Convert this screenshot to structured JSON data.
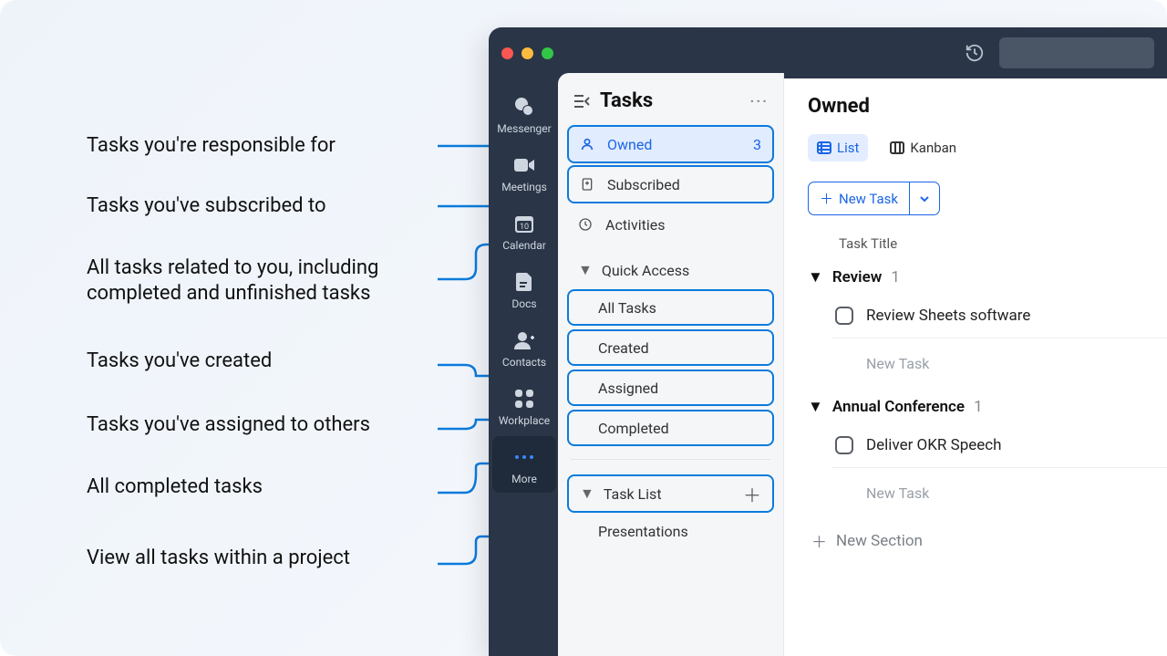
{
  "callouts": {
    "owned": "Tasks you're responsible for",
    "subscribed": "Tasks you've subscribed to",
    "activities": "All tasks related to you, including completed and unfinished tasks",
    "created": "Tasks you've created",
    "assigned": "Tasks you've assigned to others",
    "completed": "All completed tasks",
    "tasklist": "View all tasks within a project"
  },
  "nav": {
    "messenger": "Messenger",
    "meetings": "Meetings",
    "calendar": "Calendar",
    "docs": "Docs",
    "contacts": "Contacts",
    "workplace": "Workplace",
    "more": "More",
    "calendar_day": "10"
  },
  "tasks_panel": {
    "title": "Tasks",
    "owned": "Owned",
    "owned_count": "3",
    "subscribed": "Subscribed",
    "activities": "Activities",
    "quick_access": "Quick Access",
    "all_tasks": "All Tasks",
    "created": "Created",
    "assigned": "Assigned",
    "completed": "Completed",
    "task_list": "Task List",
    "presentations": "Presentations"
  },
  "main": {
    "title": "Owned",
    "view_list": "List",
    "view_kanban": "Kanban",
    "new_task": "New Task",
    "col_title": "Task Title",
    "group_review": "Review",
    "group_review_count": "1",
    "task_review_sheets": "Review Sheets software",
    "ghost_new_task": "New Task",
    "group_conf": "Annual Conference",
    "group_conf_count": "1",
    "task_okr": "Deliver OKR Speech",
    "new_section": "New Section"
  }
}
